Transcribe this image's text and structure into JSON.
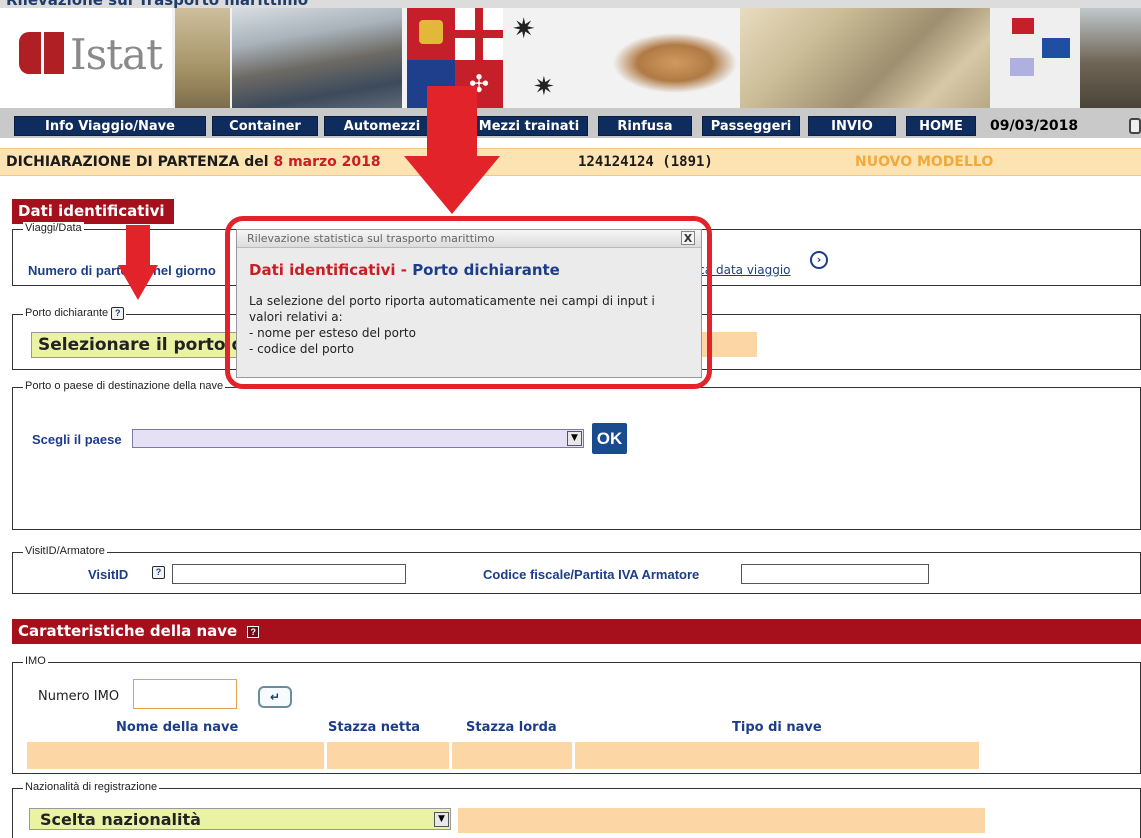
{
  "page": {
    "top_title": "Rilevazione sul Trasporto marittimo"
  },
  "banner": {
    "logo_text": "Istat"
  },
  "nav": {
    "items": [
      "Info Viaggio/Nave",
      "Container",
      "Automezzi",
      "Mezzi trainati",
      "Rinfusa",
      "Passeggeri",
      "INVIO",
      "HOME"
    ],
    "date": "09/03/2018"
  },
  "status": {
    "declaration": "DICHIARAZIONE DI PARTENZA del",
    "date": "8 marzo 2018",
    "code": "124124124 (1891)",
    "model": "NUOVO MODELLO"
  },
  "dati": {
    "header": "Dati identificativi",
    "viaggi_legend": "Viaggi/Data",
    "numero_label": "Numero di partenze nel giorno",
    "modifica_link": "Modifica data viaggio",
    "porto_legend": "Porto dichiarante",
    "porto_select": "Selezionare il porto dichiarante",
    "dest_legend": "Porto o paese di destinazione della nave",
    "scegli_label": "Scegli il paese",
    "ok_label": "OK",
    "visit_legend": "VisitID/Armatore",
    "visit_label": "VisitID",
    "cf_label": "Codice fiscale/Partita IVA Armatore"
  },
  "nave": {
    "header": "Caratteristiche della nave",
    "imo_legend": "IMO",
    "imo_label": "Numero IMO",
    "cols": [
      "Nome della nave",
      "Stazza netta",
      "Stazza lorda",
      "Tipo di nave"
    ],
    "naz_legend": "Nazionalità di registrazione",
    "naz_select": "Scelta nazionalità"
  },
  "popup": {
    "title": "Rilevazione statistica sul trasporto marittimo",
    "close": "X",
    "head_red": "Dati identificativi",
    "head_sep": " - ",
    "head_blue": "Porto dichiarante",
    "line1": "La selezione del porto riporta automaticamente nei campi di input i",
    "line2": "valori relativi a:",
    "line3": "- nome per esteso del porto",
    "line4": "- codice del porto"
  },
  "colors": {
    "nav_blue": "#0f2c5e",
    "section_red": "#a6101c",
    "highlight_red": "#e3232a",
    "peach": "#fcd6a4",
    "status_bg": "#fde3b2"
  }
}
